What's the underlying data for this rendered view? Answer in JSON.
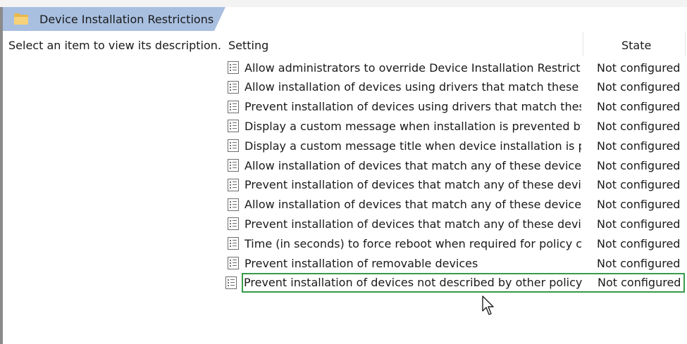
{
  "header": {
    "title": "Device Installation Restrictions"
  },
  "description_pane": {
    "text": "Select an item to view its description."
  },
  "columns": {
    "setting": "Setting",
    "state": "State"
  },
  "rows": [
    {
      "setting": "Allow administrators to override Device Installation Restricti...",
      "state": "Not configured"
    },
    {
      "setting": "Allow installation of devices using drivers that match these ...",
      "state": "Not configured"
    },
    {
      "setting": "Prevent installation of devices using drivers that match thes...",
      "state": "Not configured"
    },
    {
      "setting": "Display a custom message when installation is prevented by...",
      "state": "Not configured"
    },
    {
      "setting": "Display a custom message title when device installation is pr...",
      "state": "Not configured"
    },
    {
      "setting": "Allow installation of devices that match any of these device ...",
      "state": "Not configured"
    },
    {
      "setting": "Prevent installation of devices that match any of these devic...",
      "state": "Not configured"
    },
    {
      "setting": "Allow installation of devices that match any of these device ...",
      "state": "Not configured"
    },
    {
      "setting": "Prevent installation of devices that match any of these devic...",
      "state": "Not configured"
    },
    {
      "setting": "Time (in seconds) to force reboot when required for policy c...",
      "state": "Not configured"
    },
    {
      "setting": "Prevent installation of removable devices",
      "state": "Not configured"
    },
    {
      "setting": "Prevent installation of devices not described by other policy ...",
      "state": "Not configured"
    }
  ],
  "selected_row_index": 11,
  "colors": {
    "header_tab": "#a8bfe0",
    "selection_outline": "#3a9a4a"
  }
}
